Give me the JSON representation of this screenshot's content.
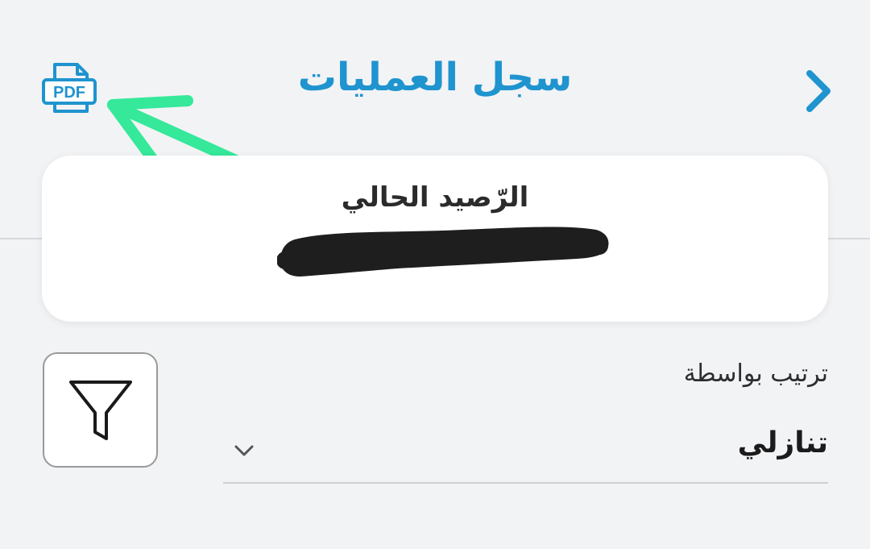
{
  "header": {
    "title": "سجل العمليات",
    "back_icon": "chevron-right-icon",
    "pdf_icon": "pdf-icon",
    "pdf_label": "PDF",
    "accent_color": "#1f94cf"
  },
  "annotation": {
    "arrow_color": "#35e89a",
    "arrow_icon": "arrow-icon"
  },
  "balance": {
    "label": "الرّصيد الحالي",
    "value": ""
  },
  "sort": {
    "label": "ترتيب بواسطة",
    "selected": "تنازلي",
    "dropdown_icon": "chevron-down-icon"
  },
  "filter": {
    "icon": "filter-icon"
  }
}
